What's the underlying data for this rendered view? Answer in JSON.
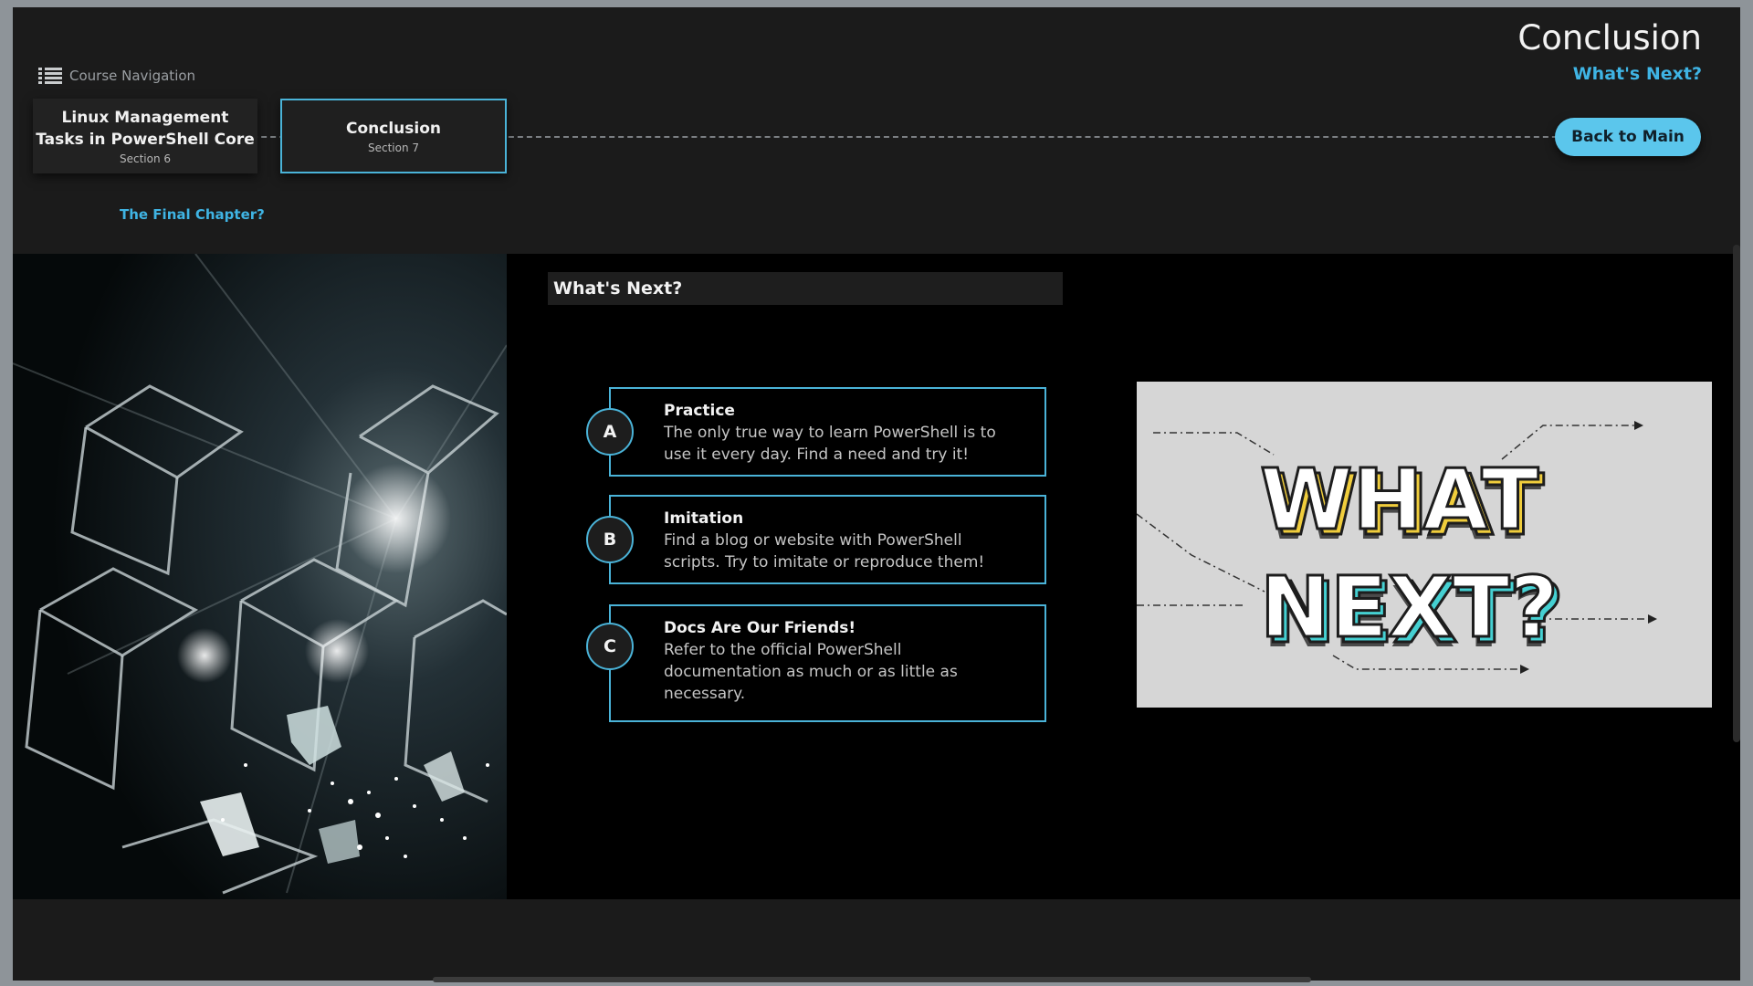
{
  "header": {
    "course_nav_label": "Course Navigation",
    "title": "Conclusion",
    "subtitle": "What's Next?",
    "back_button": "Back to Main",
    "final_chapter_link": "The Final Chapter?"
  },
  "sections": [
    {
      "title_line1": "Linux Management",
      "title_line2": "Tasks in PowerShell Core",
      "number": "Section 6",
      "active": false
    },
    {
      "title": "Conclusion",
      "number": "Section 7",
      "active": true
    }
  ],
  "main": {
    "heading": "What's Next?",
    "items": [
      {
        "badge": "A",
        "title": "Practice",
        "text_line1": "The only true way to learn PowerShell is to",
        "text_line2": "use it every day. Find a need and try it!"
      },
      {
        "badge": "B",
        "title": "Imitation",
        "text_line1": "Find a blog or website with PowerShell",
        "text_line2": "scripts. Try to imitate or reproduce them!"
      },
      {
        "badge": "C",
        "title": "Docs Are Our Friends!",
        "text_line1": "Refer to the official PowerShell",
        "text_line2": "documentation as much or as little as",
        "text_line3": "necessary."
      }
    ],
    "image_words": [
      "WHAT",
      "NEXT?"
    ]
  },
  "colors": {
    "accent": "#4ab3d8",
    "button": "#5bc6ec",
    "link": "#3fb4e4",
    "background": "#1b1b1b",
    "content_bg": "#000000",
    "letter_yellow": "#f0cd3c",
    "letter_teal": "#45d0d2"
  },
  "icons": {
    "course_nav": "menu-list-icon"
  }
}
